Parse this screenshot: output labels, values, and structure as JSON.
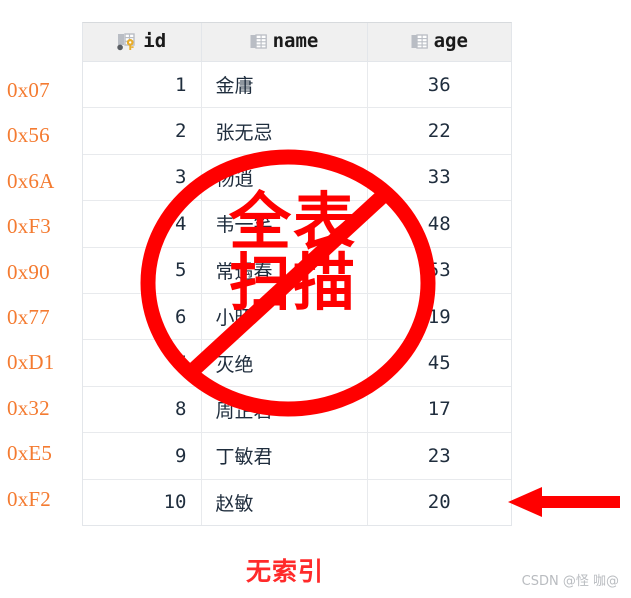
{
  "table": {
    "columns": [
      {
        "key": "id",
        "label": "id",
        "icon": "primary-key-table-icon"
      },
      {
        "key": "name",
        "label": "name",
        "icon": "table-column-icon"
      },
      {
        "key": "age",
        "label": "age",
        "icon": "table-column-icon"
      }
    ],
    "rows": [
      {
        "addr": "0x07",
        "id": "1",
        "name": "金庸",
        "age": "36"
      },
      {
        "addr": "0x56",
        "id": "2",
        "name": "张无忌",
        "age": "22"
      },
      {
        "addr": "0x6A",
        "id": "3",
        "name": "杨逍",
        "age": "33"
      },
      {
        "addr": "0xF3",
        "id": "4",
        "name": "韦一笑",
        "age": "48"
      },
      {
        "addr": "0x90",
        "id": "5",
        "name": "常遇春",
        "age": "53"
      },
      {
        "addr": "0x77",
        "id": "6",
        "name": "小昭",
        "age": "19"
      },
      {
        "addr": "0xD1",
        "id": "7",
        "name": "灭绝",
        "age": "45"
      },
      {
        "addr": "0x32",
        "id": "8",
        "name": "周芷若",
        "age": "17"
      },
      {
        "addr": "0xE5",
        "id": "9",
        "name": "丁敏君",
        "age": "23"
      },
      {
        "addr": "0xF2",
        "id": "10",
        "name": "赵敏",
        "age": "20"
      }
    ]
  },
  "overlay": {
    "line1": "全表",
    "line2": "扫描",
    "symbol": "no-entry-sign"
  },
  "caption": "无索引",
  "watermark": "CSDN @怪 咖@",
  "arrow": {
    "direction": "left",
    "color": "#FF0000"
  },
  "colors": {
    "address": "#F47B31",
    "red": "#FF0000",
    "caption_red": "#FF2A2A",
    "header_bg": "#f0f0f0",
    "grid_line": "#e8eaed",
    "key_icon": "#E8AD2B"
  }
}
